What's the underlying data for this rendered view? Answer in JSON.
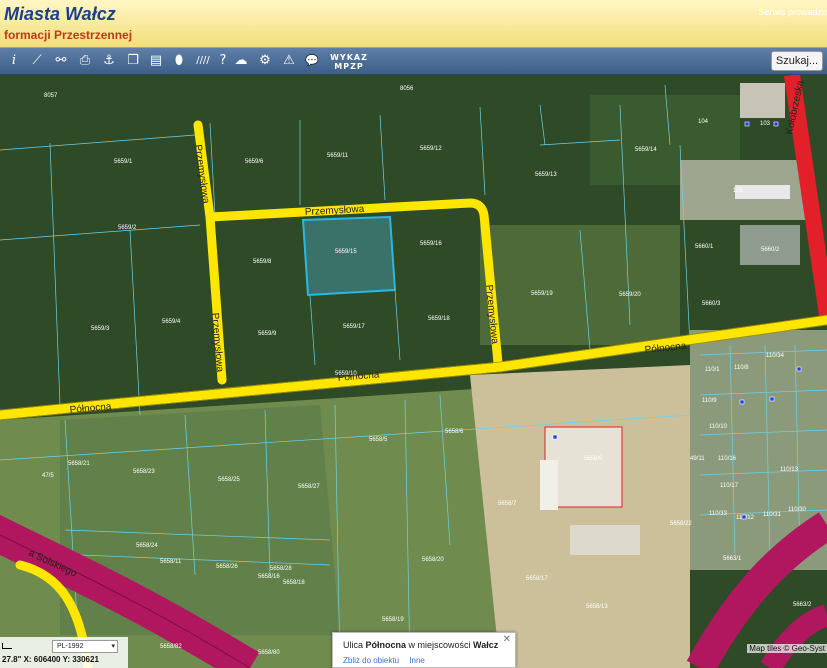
{
  "header": {
    "title": "Miasta Wałcz",
    "subtitle": "formacji Przestrzennej",
    "service": "Serwis prowadzo"
  },
  "toolbar": {
    "tools": [
      {
        "name": "info-icon",
        "glyph": "i"
      },
      {
        "name": "measure-icon",
        "glyph": "⟋"
      },
      {
        "name": "link-icon",
        "glyph": "⚯"
      },
      {
        "name": "print-icon",
        "glyph": "⎙"
      },
      {
        "name": "anchor-icon",
        "glyph": "⚓"
      },
      {
        "name": "layers-icon",
        "glyph": "❐"
      },
      {
        "name": "layout-icon",
        "glyph": "▤"
      },
      {
        "name": "shape-icon",
        "glyph": "⬮"
      },
      {
        "name": "hatch-icon",
        "glyph": "////"
      },
      {
        "name": "help-icon",
        "glyph": "?"
      },
      {
        "name": "cloud-upload-icon",
        "glyph": "☁"
      },
      {
        "name": "settings-icon",
        "glyph": "⚙"
      },
      {
        "name": "warning-icon",
        "glyph": "⚠"
      },
      {
        "name": "comment-icon",
        "glyph": "💬"
      }
    ],
    "wykaz_line1": "WYKAZ",
    "wykaz_line2": "MPZP",
    "search_label": "Szukaj..."
  },
  "map": {
    "streets": {
      "przemyslowa_w": "Przemysłowa",
      "przemyslowa_w2": "Przemysłowa",
      "przemyslowa_n": "Przemysłowa",
      "przemyslowa_e": "Przemysłowa",
      "polnocna_1": "Północna",
      "polnocna_2": "Północna",
      "polnocna_3": "Północna",
      "kolobrzeska": "Kołobrzeska",
      "solskiego": "a Solskiego"
    },
    "parcels": [
      "8057",
      "8056",
      "5659/1",
      "5659/6",
      "5659/11",
      "5659/12",
      "5659/14",
      "104",
      "5659/13",
      "5659/2",
      "5659/8",
      "5659/15",
      "5659/16",
      "5660/1",
      "5660/2",
      "5659/3",
      "5659/4",
      "5659/9",
      "5659/17",
      "5659/18",
      "5659/19",
      "5659/20",
      "5660/3",
      "5659/10",
      "5658/21",
      "5658/23",
      "5658/5",
      "5658/6",
      "5658/25",
      "5658/27",
      "5658/7",
      "5658/9",
      "5658/24",
      "5658/26",
      "5658/28",
      "5658/16",
      "5658/18",
      "5658/19",
      "5658/20",
      "5658/17",
      "5658/13",
      "5658/22",
      "5658/11",
      "5658/82",
      "5658/80",
      "5663/1",
      "5663/2",
      "110/1",
      "110/8",
      "110/9",
      "110/10",
      "110/16",
      "110/17",
      "110/33",
      "110/12",
      "110/31",
      "110/30",
      "110/13",
      "110/34",
      "103",
      "105",
      "49/11",
      "47/5"
    ]
  },
  "coords": {
    "crs": "PL-1992",
    "text": "27.8\"  X: 606400   Y: 330621"
  },
  "popup": {
    "prefix": "Ulica ",
    "street": "Północna",
    "middle": " w miejscowości ",
    "town": "Wałcz",
    "zoom_link": "Zbliż do obiektu",
    "other_link": "Inne",
    "close": "✕"
  },
  "attribution": "Map tiles © Geo-Syst",
  "colors": {
    "forest": "#2f4f28",
    "meadow": "#6e8a4c",
    "road_yellow": "#ffe600",
    "road_red": "#e3202a",
    "road_magenta": "#b0175e",
    "parcel_line": "#6fd3e6",
    "selected": "#29b8e6"
  }
}
